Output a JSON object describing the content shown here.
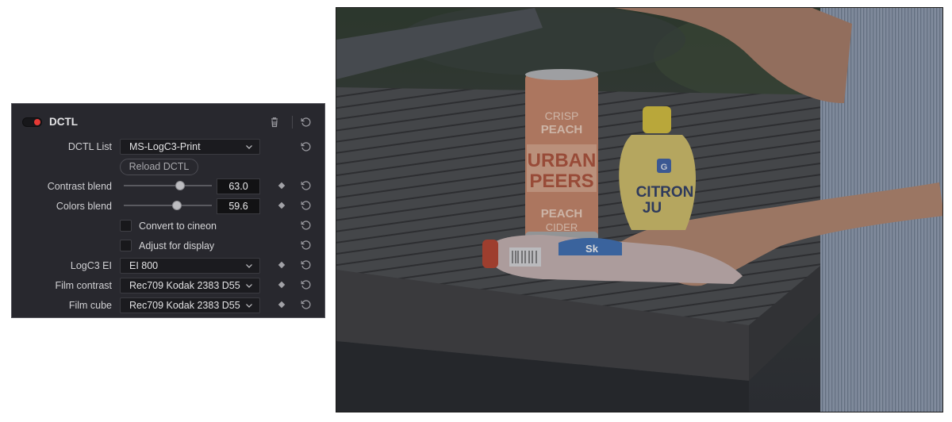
{
  "panel": {
    "title": "DCTL",
    "enabled": true,
    "icons": {
      "delete": "trash-icon",
      "reset": "reset-icon",
      "keyframe": "keyframe-diamond-icon",
      "dropdown": "chevron-down-icon"
    },
    "accent_color": "#e53935",
    "rows": {
      "dctl_list": {
        "label": "DCTL List",
        "value": "MS-LogC3-Print"
      },
      "reload_button": "Reload DCTL",
      "contrast_blend": {
        "label": "Contrast blend",
        "value": "63.0",
        "slider_fraction": 0.63
      },
      "colors_blend": {
        "label": "Colors blend",
        "value": "59.6",
        "slider_fraction": 0.596
      },
      "convert_cineon": {
        "label": "Convert to cineon",
        "checked": false
      },
      "adjust_display": {
        "label": "Adjust for display",
        "checked": false
      },
      "logc3_ei": {
        "label": "LogC3 EI",
        "value": "EI 800"
      },
      "film_contrast": {
        "label": "Film contrast",
        "value": "Rec709 Kodak 2383 D55"
      },
      "film_cube": {
        "label": "Film cube",
        "value": "Rec709 Kodak 2383 D55"
      }
    }
  },
  "photo": {
    "subject": "Drinks on a wooden outdoor table",
    "can_text": {
      "line1": "CRISP",
      "line2": "PEACH",
      "line3": "URBAN",
      "line4": "PEERS",
      "line5": "PEACH",
      "line6": "CIDER"
    },
    "bottle_text": {
      "line1": "CITRON",
      "line2": "JU",
      "badge": "G"
    },
    "tube_text": "Sk"
  }
}
